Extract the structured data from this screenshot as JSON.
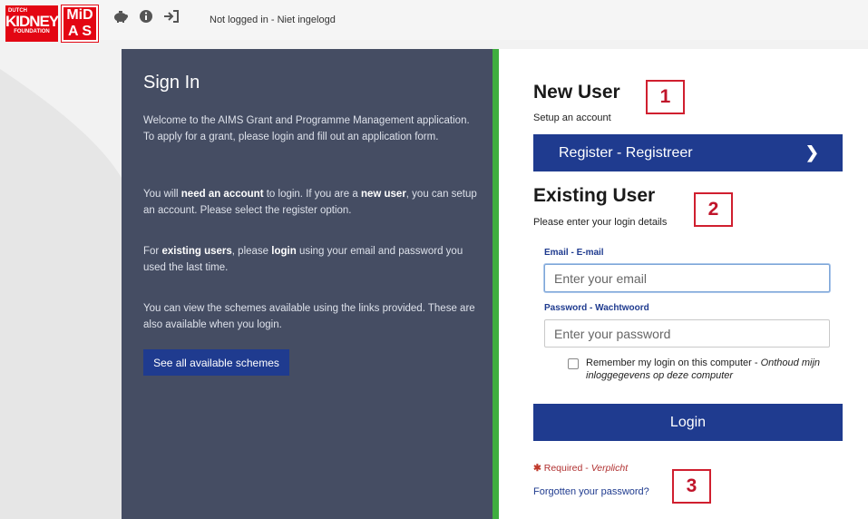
{
  "header": {
    "logo_kidney_small": "DUTCH",
    "logo_kidney_main": "KIDNEY",
    "logo_kidney_sub": "FOUNDATION",
    "logo_midas_line1": "MiD",
    "logo_midas_line2": "A S",
    "icons": [
      "piggy-bank-icon",
      "info-icon",
      "sign-in-icon"
    ],
    "login_status": "Not logged in - Niet ingelogd"
  },
  "left": {
    "title": "Sign In",
    "p1": "Welcome to the AIMS Grant and Programme Management application. To apply for a grant, please login and fill out an application form.",
    "p2_a": "You will ",
    "p2_b": "need an account",
    "p2_c": " to login. If you are a ",
    "p2_d": "new user",
    "p2_e": ", you can setup an account. Please select the register option.",
    "p3_a": "For ",
    "p3_b": "existing users",
    "p3_c": ", please ",
    "p3_d": "login",
    "p3_e": " using your email and password you used the last time.",
    "p4": "You can view the schemes available using the links provided. These are also available when you login.",
    "schemes_button": "See all available schemes"
  },
  "right": {
    "new_user_title": "New User",
    "new_user_sub": "Setup an account",
    "register_button": "Register - Registreer",
    "existing_title": "Existing User",
    "existing_sub": "Please enter your login details",
    "email_label": "Email - E-mail",
    "email_placeholder": "Enter your email",
    "password_label": "Password - Wachtwoord",
    "password_placeholder": "Enter your password",
    "remember_text": "Remember my login on this computer - ",
    "remember_text_nl": "Onthoud mijn inloggegevens op deze computer",
    "login_button": "Login",
    "required_star": "✱",
    "required_text": "Required - ",
    "required_text_nl": "Verplicht",
    "forgot_link": "Forgotten your password?"
  },
  "markers": [
    "1",
    "2",
    "3"
  ],
  "colors": {
    "brand_red": "#e30613",
    "primary_blue": "#1f3b8f",
    "panel_dark": "#454d63",
    "accent_green": "#3fae3f",
    "marker_red": "#d01f2f"
  }
}
